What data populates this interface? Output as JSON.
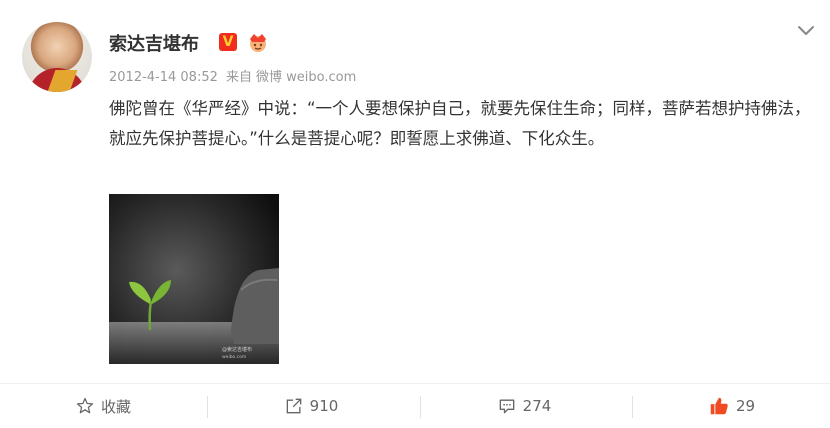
{
  "user": {
    "name": "索达吉堪布",
    "verified_badge": "V"
  },
  "meta": {
    "timestamp": "2012-4-14 08:52",
    "from_label": "来自",
    "source": "微博 weibo.com"
  },
  "post": {
    "text": "佛陀曾在《华严经》中说：“一个人要想保护自己，就要先保住生命；同样，菩萨若想护持佛法，就应先保护菩提心。”什么是菩提心呢？即誓愿上求佛道、下化众生。"
  },
  "actions": {
    "favorite": {
      "label": "收藏",
      "icon": "star-icon"
    },
    "repost": {
      "count": "910",
      "icon": "repost-icon"
    },
    "comment": {
      "count": "274",
      "icon": "comment-icon"
    },
    "like": {
      "count": "29",
      "icon": "thumbs-up-icon"
    }
  },
  "colors": {
    "like_accent": "#f04b23",
    "badge_red": "#f02c1c",
    "muted_text": "#999999"
  }
}
